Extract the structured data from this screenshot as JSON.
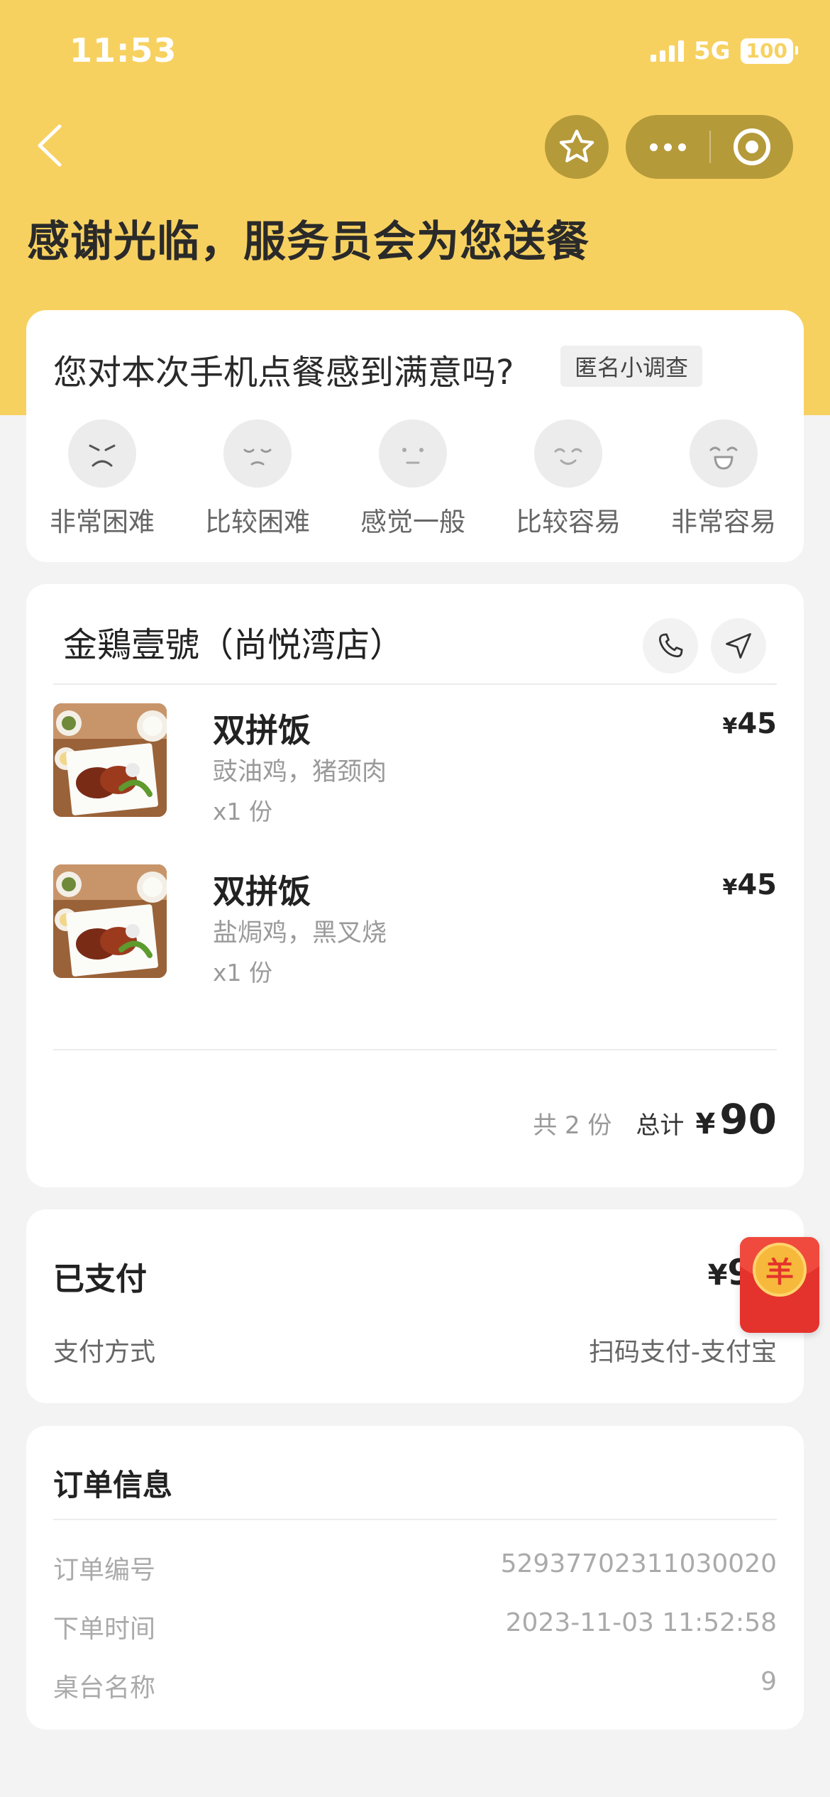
{
  "status_bar": {
    "time": "11:53",
    "network": "5G",
    "battery": "100"
  },
  "header": {
    "title": "感谢光临，服务员会为您送餐"
  },
  "survey": {
    "question": "您对本次手机点餐感到满意吗?",
    "tag": "匿名小调查",
    "options": [
      {
        "label": "非常困难",
        "icon": "very-sad-face-icon"
      },
      {
        "label": "比较困难",
        "icon": "sad-face-icon"
      },
      {
        "label": "感觉一般",
        "icon": "neutral-face-icon"
      },
      {
        "label": "比较容易",
        "icon": "smile-face-icon"
      },
      {
        "label": "非常容易",
        "icon": "laugh-face-icon"
      }
    ]
  },
  "order": {
    "store": "金鶏壹號（尚悦湾店）",
    "items": [
      {
        "name": "双拼饭",
        "desc": "豉油鸡，猪颈肉",
        "qty": "x1 份",
        "currency": "¥",
        "price": "45"
      },
      {
        "name": "双拼饭",
        "desc": "盐焗鸡，黑叉烧",
        "qty": "x1 份",
        "currency": "¥",
        "price": "45"
      }
    ],
    "count": "共 2 份",
    "total_label": "总计",
    "total_currency": "¥",
    "total": "90"
  },
  "payment": {
    "status": "已支付",
    "currency": "¥",
    "amount": "90",
    "method_label": "支付方式",
    "method": "扫码支付-支付宝"
  },
  "order_info": {
    "title": "订单信息",
    "rows": [
      {
        "key": "订单编号",
        "value": "52937702311030020"
      },
      {
        "key": "下单时间",
        "value": "2023-11-03 11:52:58"
      },
      {
        "key": "桌台名称",
        "value": "9"
      }
    ]
  },
  "red_packet": {
    "symbol": "羊"
  },
  "colors": {
    "header_yellow": "#f7d160",
    "capsule": "#b59a3a",
    "red_packet": "#e4332c"
  }
}
